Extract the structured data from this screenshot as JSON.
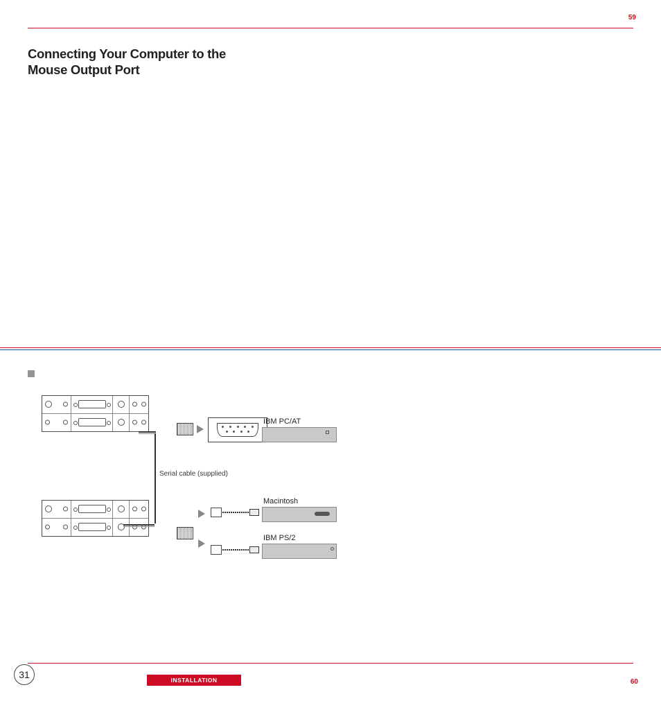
{
  "header": {
    "page_top": "59"
  },
  "section": {
    "title_line1": "Connecting Your Computer to the",
    "title_line2": "Mouse Output Port"
  },
  "diagram": {
    "serial_cable_label": "Serial cable (supplied)",
    "label_pcat": "IBM PC/AT",
    "label_mac": "Macintosh",
    "label_ps2": "IBM PS/2"
  },
  "footer": {
    "page_left": "31",
    "tab_label": "INSTALLATION",
    "page_right": "60"
  }
}
